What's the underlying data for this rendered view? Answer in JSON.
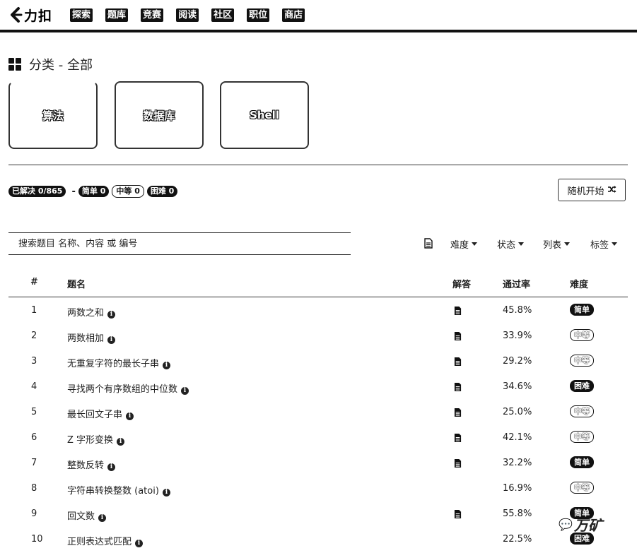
{
  "nav": {
    "logo_text": "力扣",
    "links": [
      "探索",
      "题库",
      "竞赛",
      "阅读",
      "社区",
      "职位",
      "商店"
    ]
  },
  "category": {
    "title": "分类 - 全部",
    "cards": [
      "算法",
      "数据库",
      "Shell"
    ]
  },
  "stats": {
    "solved": "已解决 0/865",
    "separator": "-",
    "easy": "简单 0",
    "medium": "中等 0",
    "hard": "困难 0"
  },
  "random_button": {
    "label": "随机开始"
  },
  "search": {
    "placeholder": "搜索题目 名称、内容 或 编号"
  },
  "filters": [
    "难度",
    "状态",
    "列表",
    "标签"
  ],
  "table": {
    "headers": [
      "#",
      "题名",
      "解答",
      "通过率",
      "难度"
    ],
    "rows": [
      {
        "num": "1",
        "title": "两数之和",
        "has_solution": true,
        "rate": "45.8%",
        "difficulty": "简单",
        "level": "easy"
      },
      {
        "num": "2",
        "title": "两数相加",
        "has_solution": true,
        "rate": "33.9%",
        "difficulty": "中等",
        "level": "medium"
      },
      {
        "num": "3",
        "title": "无重复字符的最长子串",
        "has_solution": true,
        "rate": "29.2%",
        "difficulty": "中等",
        "level": "medium"
      },
      {
        "num": "4",
        "title": "寻找两个有序数组的中位数",
        "has_solution": true,
        "rate": "34.6%",
        "difficulty": "困难",
        "level": "hard"
      },
      {
        "num": "5",
        "title": "最长回文子串",
        "has_solution": true,
        "rate": "25.0%",
        "difficulty": "中等",
        "level": "medium"
      },
      {
        "num": "6",
        "title": "Z 字形变换",
        "has_solution": true,
        "rate": "42.1%",
        "difficulty": "中等",
        "level": "medium"
      },
      {
        "num": "7",
        "title": "整数反转",
        "has_solution": true,
        "rate": "32.2%",
        "difficulty": "简单",
        "level": "easy"
      },
      {
        "num": "8",
        "title": "字符串转换整数 (atoi)",
        "has_solution": false,
        "rate": "16.9%",
        "difficulty": "中等",
        "level": "medium"
      },
      {
        "num": "9",
        "title": "回文数",
        "has_solution": true,
        "rate": "55.8%",
        "difficulty": "简单",
        "level": "easy"
      },
      {
        "num": "10",
        "title": "正则表达式匹配",
        "has_solution": false,
        "rate": "22.5%",
        "difficulty": "困难",
        "level": "hard"
      }
    ]
  },
  "watermark": {
    "text": "万矿"
  }
}
